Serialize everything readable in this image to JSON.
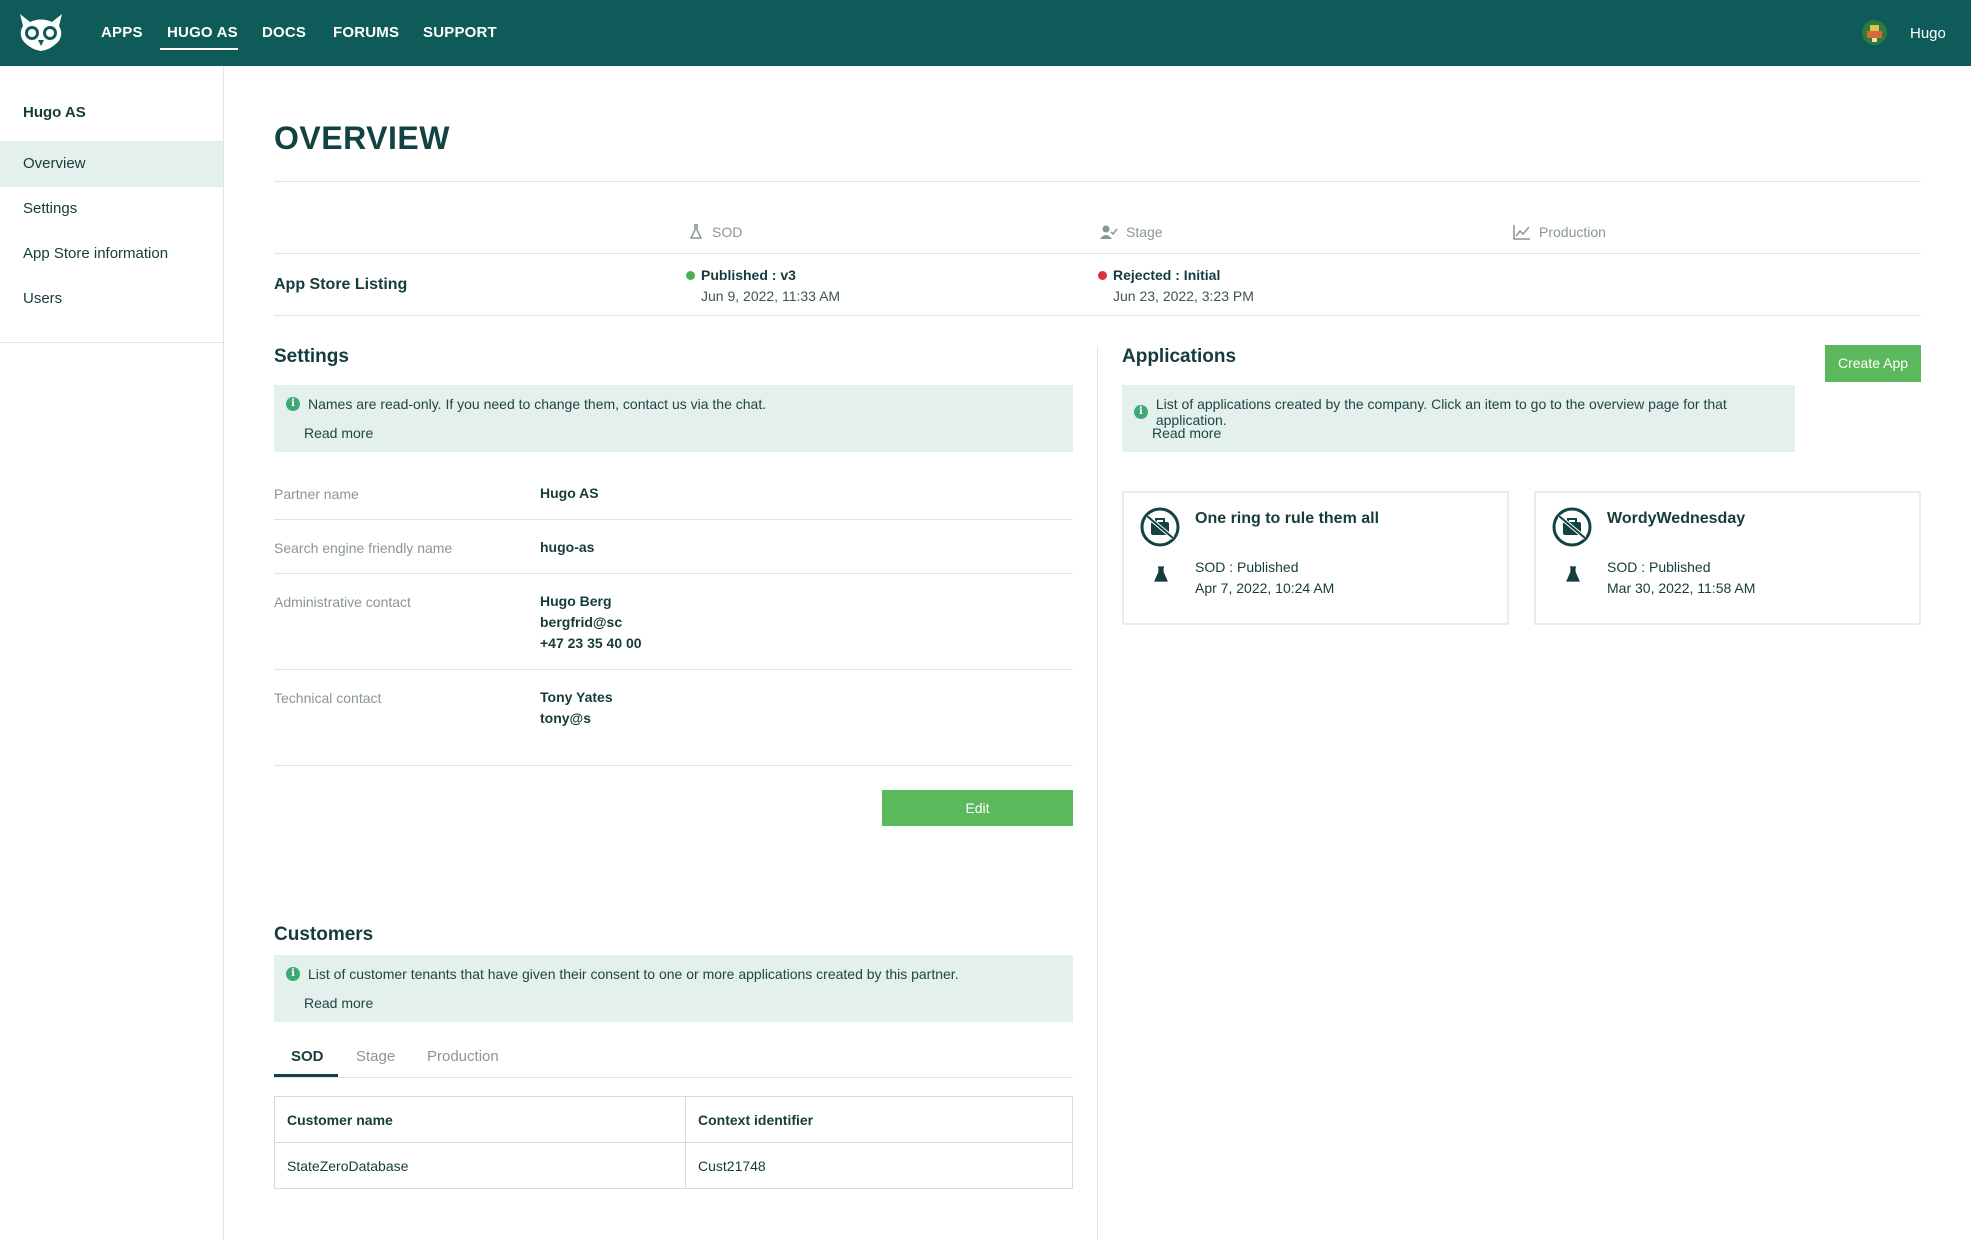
{
  "nav": {
    "items": [
      "APPS",
      "HUGO AS",
      "DOCS",
      "FORUMS",
      "SUPPORT"
    ],
    "active": "HUGO AS",
    "user_name": "Hugo"
  },
  "sidebar": {
    "title": "Hugo AS",
    "items": [
      {
        "label": "Overview",
        "active": true
      },
      {
        "label": "Settings",
        "active": false
      },
      {
        "label": "App Store information",
        "active": false
      },
      {
        "label": "Users",
        "active": false
      }
    ]
  },
  "overview": {
    "title": "OVERVIEW",
    "environments": [
      {
        "label": "SOD",
        "icon": "flask-icon"
      },
      {
        "label": "Stage",
        "icon": "user-check-icon"
      },
      {
        "label": "Production",
        "icon": "line-chart-icon"
      }
    ],
    "listing": {
      "label": "App Store Listing",
      "sod": {
        "status": "Published : v3",
        "date": "Jun 9, 2022, 11:33 AM",
        "color": "#4cb050"
      },
      "stage": {
        "status": "Rejected : Initial",
        "date": "Jun 23, 2022, 3:23 PM",
        "color": "#d9343d"
      }
    }
  },
  "settings": {
    "title": "Settings",
    "info": "Names are read-only. If you need to change them, contact us via the chat.",
    "read_more": "Read more",
    "fields": {
      "partner_name": {
        "label": "Partner name",
        "value": "Hugo AS"
      },
      "seo_name": {
        "label": "Search engine friendly name",
        "value": "hugo-as"
      },
      "admin_contact": {
        "label": "Administrative contact",
        "name": "Hugo Berg",
        "email": "bergfrid@sc",
        "phone": "+47 23 35 40 00"
      },
      "tech_contact": {
        "label": "Technical contact",
        "name": "Tony Yates",
        "email": "tony@s"
      }
    },
    "edit_label": "Edit"
  },
  "applications": {
    "title": "Applications",
    "create_label": "Create App",
    "info": "List of applications created by the company. Click an item to go to the overview page for that application.",
    "read_more": "Read more",
    "apps": [
      {
        "name": "One ring to rule them all",
        "status": "SOD : Published",
        "date": "Apr 7, 2022, 10:24 AM"
      },
      {
        "name": "WordyWednesday",
        "status": "SOD : Published",
        "date": "Mar 30, 2022, 11:58 AM"
      }
    ]
  },
  "customers": {
    "title": "Customers",
    "info": "List of customer tenants that have given their consent to one or more applications created by this partner.",
    "read_more": "Read more",
    "tabs": [
      "SOD",
      "Stage",
      "Production"
    ],
    "active_tab": "SOD",
    "columns": [
      "Customer name",
      "Context identifier"
    ],
    "rows": [
      [
        "StateZeroDatabase",
        "Cust21748"
      ]
    ]
  },
  "colors": {
    "topbar": "#0e5b59",
    "accent_green": "#5cb85c",
    "info_bg": "#e4f0ec"
  }
}
